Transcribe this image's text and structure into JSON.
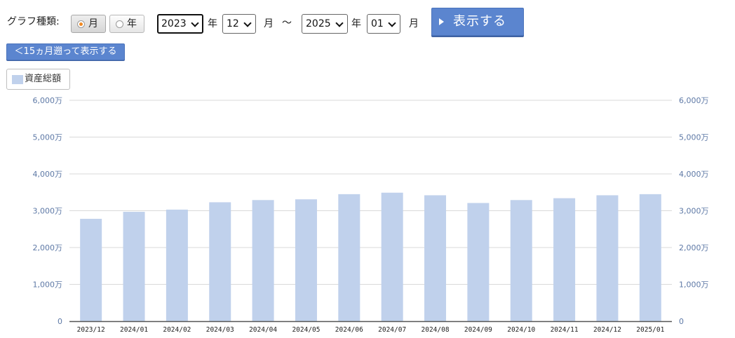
{
  "controls": {
    "graph_type_label": "グラフ種類:",
    "radio_month": "月",
    "radio_year": "年",
    "selected_type": "月",
    "start_year": "2023",
    "start_year_unit": "年",
    "start_month": "12",
    "start_month_unit": "月",
    "range_sep": "～",
    "end_year": "2025",
    "end_year_unit": "年",
    "end_month": "01",
    "end_month_unit": "月",
    "show_button": "表示する",
    "back_button": "＜15ヵ月遡って表示する"
  },
  "colors": {
    "bar": "#c0d1ec",
    "button": "#5b85cf",
    "grid": "#d9d9d9",
    "axis_labels": "#5e79a6"
  },
  "chart_data": {
    "type": "bar",
    "legend": "資産総額",
    "legend_position": "top-left",
    "categories": [
      "2023/12",
      "2024/01",
      "2024/02",
      "2024/03",
      "2024/04",
      "2024/05",
      "2024/06",
      "2024/07",
      "2024/08",
      "2024/09",
      "2024/10",
      "2024/11",
      "2024/12",
      "2025/01"
    ],
    "series": [
      {
        "name": "資産総額",
        "values": [
          2780,
          2970,
          3030,
          3230,
          3290,
          3310,
          3450,
          3490,
          3420,
          3210,
          3290,
          3340,
          3420,
          3450
        ]
      }
    ],
    "ylim": [
      0,
      6000
    ],
    "yticks": [
      "0",
      "1,000万",
      "2,000万",
      "3,000万",
      "4,000万",
      "5,000万",
      "6,000万"
    ],
    "ytick_values": [
      0,
      1000,
      2000,
      3000,
      4000,
      5000,
      6000
    ],
    "y_unit": "万",
    "grid": true,
    "dual_y_axis": true
  }
}
